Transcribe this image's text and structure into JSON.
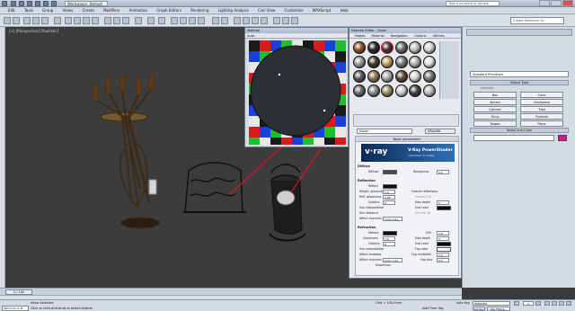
{
  "titlebar": {
    "workspace": "Workspace: Default",
    "search_placeholder": "Type a keyword or phrase"
  },
  "menubar": {
    "items": [
      "Edit",
      "Tools",
      "Group",
      "Views",
      "Create",
      "Modifiers",
      "Animation",
      "Graph Editors",
      "Rendering",
      "Lighting Analysis",
      "Civil View",
      "Customize",
      "MAXScript",
      "Help"
    ]
  },
  "toolbar": {
    "selection_set_placeholder": "Create Selection Se"
  },
  "viewport": {
    "label": "[+] [Perspective] [Realistic]"
  },
  "material_window": {
    "title": "Material",
    "toolbar_text": "Auto"
  },
  "slate": {
    "title": "Material Editor - Dover",
    "menu": [
      "Modes",
      "Material",
      "Navigation",
      "Options",
      "Utilities"
    ],
    "material_name": "Dover",
    "material_type": "VRayMtl",
    "basic_params_title": "Basic parameters",
    "banner": {
      "logo": "v·ray",
      "title": "V-Ray PowerShader",
      "subtitle": "optimized for V-Ray"
    },
    "diffuse": {
      "section": "Diffuse",
      "diffuse_label": "Diffuse",
      "roughness_label": "Roughness",
      "roughness_value": "0.0"
    },
    "reflection": {
      "section": "Reflection",
      "reflect_label": "Reflect",
      "hilight_label": "Hilight. glossiness",
      "hilight_value": "1.0",
      "refl_gloss_label": "Refl. glossiness",
      "refl_gloss_value": "0.98",
      "subdivs_label": "Subdivs",
      "subdivs_value": "8",
      "use_interp_label": "Use interpolation",
      "dim_distance_label": "Dim distance",
      "affect_channels_label": "Affect channels",
      "affect_channels_value": "Color only",
      "fresnel_label": "Fresnel reflections",
      "fresnel_ior_label": "Fresnel IOR",
      "max_depth_label": "Max depth",
      "max_depth_value": "5",
      "exit_color_label": "Exit color",
      "dim_falloff_label": "Dim fall off"
    },
    "refraction": {
      "section": "Refraction",
      "refract_label": "Refract",
      "glossiness_label": "Glossiness",
      "glossiness_value": "1.0",
      "subdivs_label": "Subdivs",
      "subdivs_value": "8",
      "use_interp_label": "Use interpolation",
      "affect_shadows_label": "Affect shadows",
      "affect_channels_label": "Affect channels",
      "affect_channels_value": "Color only",
      "dispersion_label": "Dispersion",
      "ior_label": "IOR",
      "ior_value": "1.6",
      "max_depth_label": "Max depth",
      "max_depth_value": "5",
      "exit_color_label": "Exit color",
      "fog_color_label": "Fog color",
      "fog_multiplier_label": "Fog multiplier",
      "fog_multiplier_value": "1.0",
      "fog_bias_label": "Fog bias",
      "fog_bias_value": "0.0"
    }
  },
  "command_panel": {
    "dropdown": "Standard Primitives",
    "object_type_title": "Object Type",
    "autogrid_label": "AutoGrid",
    "objects": [
      "Box",
      "Cone",
      "Sphere",
      "GeoSphere",
      "Cylinder",
      "Tube",
      "Torus",
      "Pyramid",
      "Teapot",
      "Plane"
    ],
    "name_color_title": "Name and Color"
  },
  "timeline": {
    "slider_label": "0 / 100"
  },
  "statusbar": {
    "selection_text": "None Selected",
    "prompt_text": "Click or click-and-drag to select objects",
    "maxscript_text": "Welcome to M",
    "grid_text": "Grid = 100,0mm",
    "add_time_tag": "Add Time Tag",
    "auto_key": "Auto Key",
    "selected_dd": "Selected",
    "set_key": "Set Key",
    "key_filters": "Key Filters...",
    "frame_value": "0"
  },
  "colors": {
    "accent_link": "#e0102b",
    "object_color": "#e0118d"
  }
}
